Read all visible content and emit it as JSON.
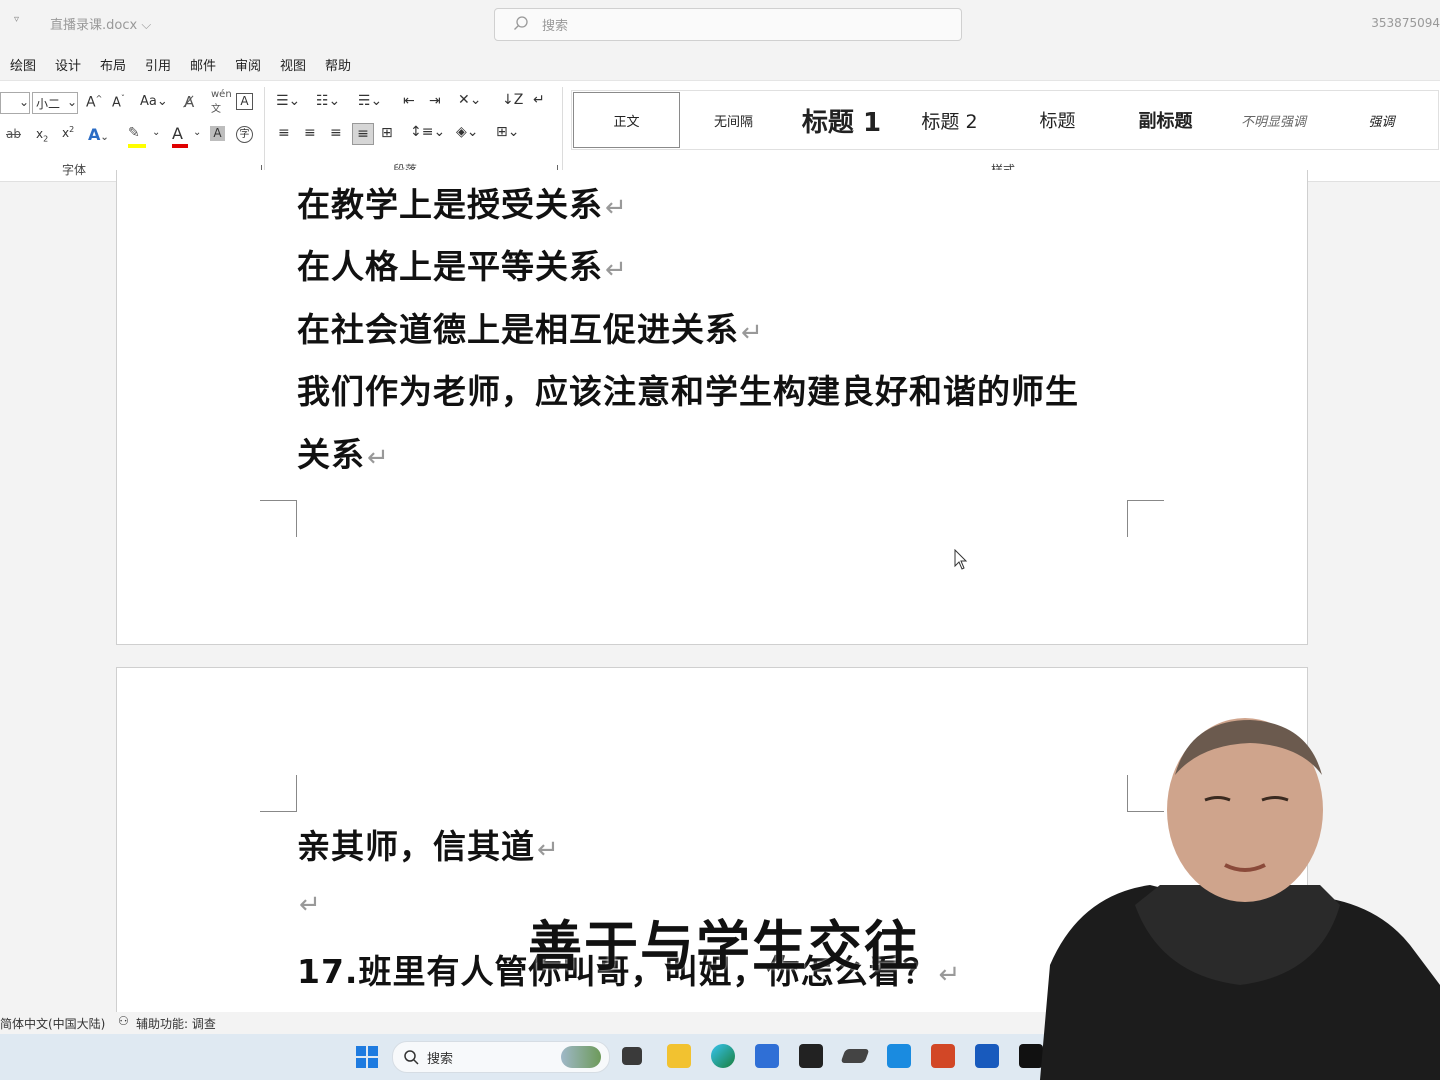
{
  "window": {
    "doc_title": "直播录课.docx",
    "search_placeholder": "搜索",
    "account": "353875094"
  },
  "menu": [
    "绘图",
    "设计",
    "布局",
    "引用",
    "邮件",
    "审阅",
    "视图",
    "帮助"
  ],
  "ribbon": {
    "font_size": "小二",
    "font_group_label": "字体",
    "paragraph_group_label": "段落",
    "styles_group_label": "样式",
    "styles": [
      "正文",
      "无间隔",
      "标题 1",
      "标题 2",
      "标题",
      "副标题",
      "不明显强调",
      "强调"
    ]
  },
  "document": {
    "page1_lines": [
      "在教学上是授受关系",
      "在人格上是平等关系",
      "在社会道德上是相互促进关系",
      "我们作为老师，应该注意和学生构建良好和谐的师生",
      "关系"
    ],
    "page2_lines": [
      "亲其师，信其道",
      "",
      "17.班里有人管你叫哥，叫姐，你怎么看？"
    ],
    "paragraph_mark": "↵"
  },
  "overlay_caption": "善于与学生交往",
  "statusbar": {
    "language": "简体中文(中国大陆)",
    "accessibility": "辅助功能: 调查"
  },
  "taskbar": {
    "search_placeholder": "搜索"
  },
  "colors": {
    "accent_word": "#185abd",
    "highlight": "#ffff00",
    "font_color": "#e00000"
  }
}
